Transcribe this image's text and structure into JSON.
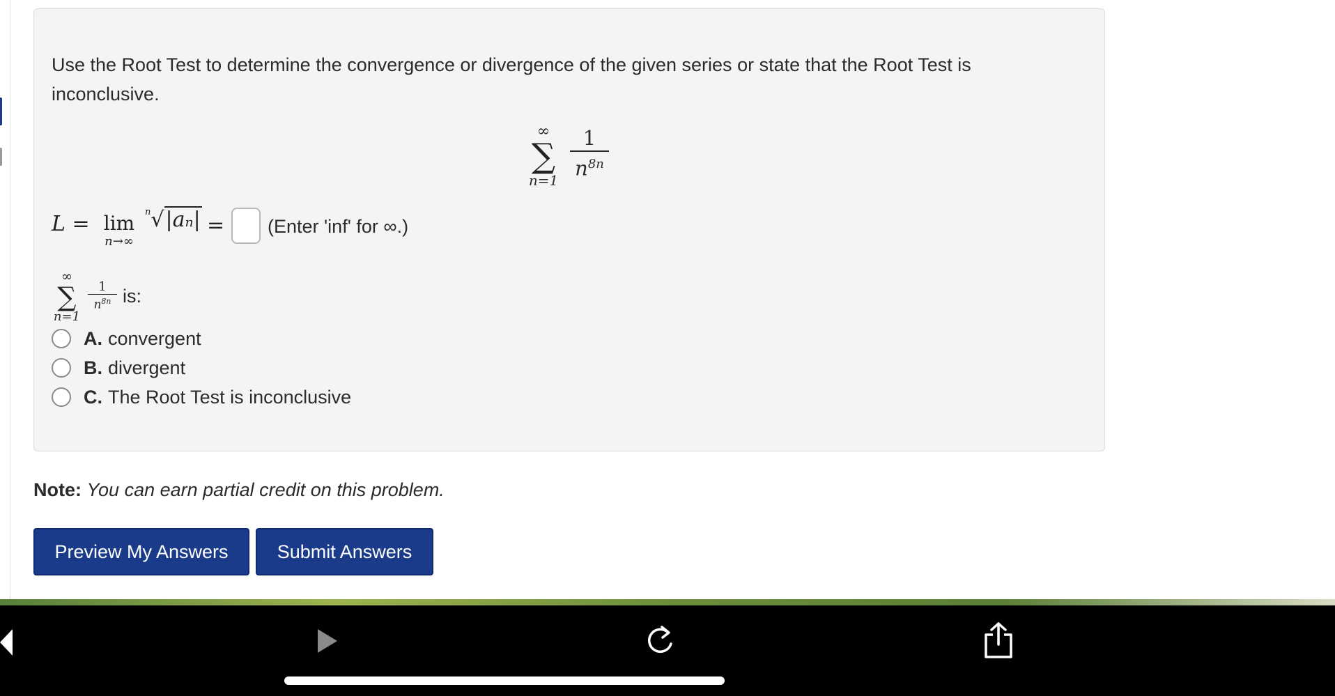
{
  "problem": {
    "instruction": "Use the Root Test to determine the convergence or divergence of the given series or state that the Root Test is inconclusive.",
    "series": {
      "upper": "∞",
      "lower": "n=1",
      "numerator": "1",
      "denominator": "n",
      "exponent": "8n"
    },
    "limit_equation": {
      "lhs": "L =",
      "lim_word": "lim",
      "lim_sub": "n→∞",
      "root_index": "n",
      "radicand": "|aₙ|",
      "equals": "=",
      "input_value": "",
      "hint": "(Enter 'inf' for ∞.)"
    },
    "series_question_suffix": "is:",
    "options": [
      {
        "letter": "A.",
        "text": "convergent"
      },
      {
        "letter": "B.",
        "text": "divergent"
      },
      {
        "letter": "C.",
        "text": "The Root Test is inconclusive"
      }
    ]
  },
  "note": {
    "label": "Note:",
    "text": "You can earn partial credit on this problem."
  },
  "buttons": {
    "preview": "Preview My Answers",
    "submit": "Submit Answers"
  },
  "colors": {
    "button_bg": "#1a3a8a",
    "panel_bg": "#f4f4f4",
    "bottom_bar": "#000000"
  },
  "toolbar_icons": [
    "back-triangle-icon",
    "play-icon",
    "reload-icon",
    "share-icon"
  ]
}
